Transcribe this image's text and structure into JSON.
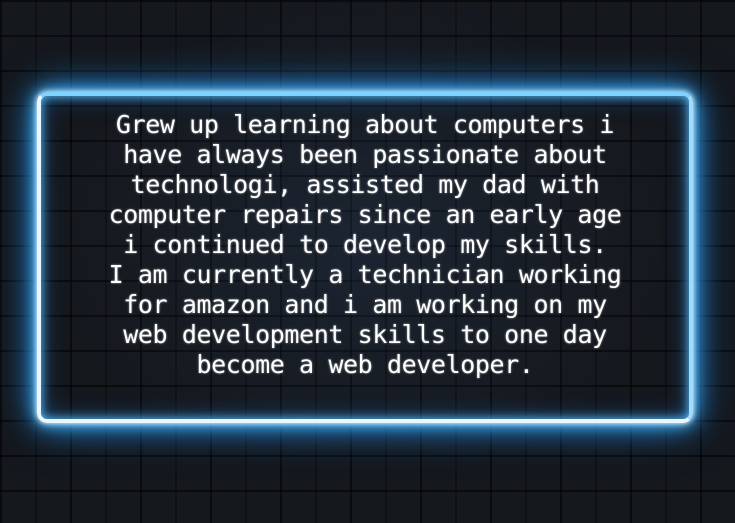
{
  "bio": {
    "text": "Grew up learning about computers i\nhave always been passionate about\ntechnologi, assisted my dad with\ncomputer repairs since an early age\ni continued to develop my skills.\nI am currently a technician working\nfor amazon and i am working on my\nweb development skills to one day\nbecome a web developer."
  },
  "colors": {
    "background": "#15181d",
    "neon_glow": "#2aa7ff",
    "neon_core": "#eaf7ff",
    "text": "#ffffff"
  }
}
